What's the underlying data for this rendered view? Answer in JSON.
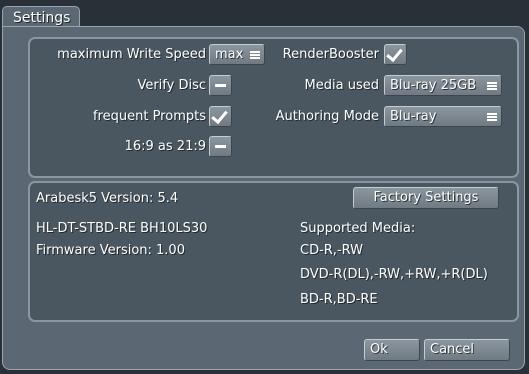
{
  "tab_title": "Settings",
  "options": {
    "max_write_speed": {
      "label": "maximum Write Speed",
      "value": "max"
    },
    "verify_disc": {
      "label": "Verify Disc",
      "state": "off"
    },
    "frequent_prompts": {
      "label": "frequent Prompts",
      "state": "on"
    },
    "aspect_16_9": {
      "label": "16:9 as 21:9",
      "state": "off"
    },
    "render_booster": {
      "label": "RenderBooster",
      "state": "on"
    },
    "media_used": {
      "label": "Media used",
      "value": "Blu-ray 25GB"
    },
    "authoring_mode": {
      "label": "Authoring Mode",
      "value": "Blu-ray"
    }
  },
  "info": {
    "version": "Arabesk5 Version: 5.4",
    "drive": "HL-DT-STBD-RE  BH10LS30",
    "firmware": "Firmware Version: 1.00",
    "supported_media_title": "Supported Media:",
    "media_list": [
      "CD-R,-RW",
      "DVD-R(DL),-RW,+RW,+R(DL)",
      "BD-R,BD-RE"
    ],
    "factory_settings_label": "Factory Settings"
  },
  "footer": {
    "ok_label": "Ok",
    "cancel_label": "Cancel"
  }
}
